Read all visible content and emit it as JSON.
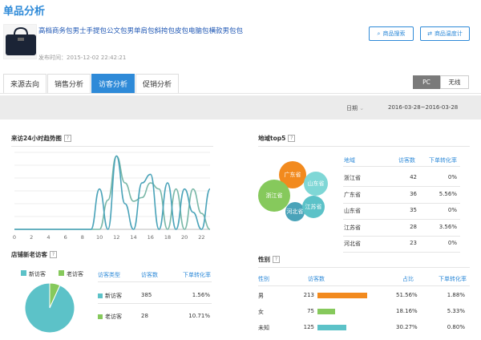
{
  "page_title": "单品分析",
  "product": {
    "name": "高档商务包男士手提包公文包男单肩包斜挎包皮包电脑包横款男包包",
    "publish_label": "发布时间：2015-12-02 22:42:21"
  },
  "buttons": {
    "search": "商品搜索",
    "temperature": "商品温度计"
  },
  "tabs": [
    "来源去向",
    "销售分析",
    "访客分析",
    "促销分析"
  ],
  "device": {
    "pc": "PC",
    "wireless": "无线"
  },
  "date": {
    "label": "日期",
    "range": "2016-03-28~2016-03-28"
  },
  "trend": {
    "title": "来访24小时趋势图",
    "x_ticks": [
      "0",
      "2",
      "4",
      "6",
      "8",
      "10",
      "12",
      "14",
      "16",
      "18",
      "20",
      "22"
    ]
  },
  "chart_data": {
    "type": "line",
    "x": [
      0,
      1,
      2,
      3,
      4,
      5,
      6,
      7,
      8,
      9,
      10,
      11,
      12,
      13,
      14,
      15,
      16,
      17,
      18,
      19,
      20,
      21,
      22,
      23
    ],
    "series": [
      {
        "color": "#7ab8a8",
        "values": [
          0,
          0,
          0,
          0,
          0,
          0,
          0,
          0,
          0,
          0,
          0,
          2.4,
          6,
          3.8,
          2.3,
          2.6,
          3.8,
          3.3,
          0,
          3.3,
          0,
          3.3,
          1.3,
          0
        ]
      },
      {
        "color": "#4aa3b9",
        "values": [
          0,
          0,
          0,
          0,
          0,
          0,
          0,
          0,
          0,
          0,
          3.3,
          0,
          6,
          2.1,
          0,
          3.8,
          4.5,
          0,
          3.8,
          0,
          3.3,
          1.4,
          0,
          3.3
        ]
      }
    ],
    "ylim": [
      0,
      6.3
    ]
  },
  "newold": {
    "title": "店铺新老访客",
    "legend": [
      "新访客",
      "老访客"
    ],
    "headers": [
      "访客类型",
      "访客数",
      "下单转化率"
    ],
    "rows": [
      {
        "type": "新访客",
        "count": "385",
        "rate": "1.56%",
        "color": "#5cc2c8"
      },
      {
        "type": "老访客",
        "count": "28",
        "rate": "10.71%",
        "color": "#86c95c"
      }
    ],
    "pie": {
      "new": 385,
      "old": 28
    }
  },
  "region": {
    "title": "地域top5",
    "headers": [
      "地域",
      "访客数",
      "下单转化率"
    ],
    "rows": [
      {
        "name": "浙江省",
        "count": "42",
        "rate": "0%"
      },
      {
        "name": "广东省",
        "count": "36",
        "rate": "5.56%"
      },
      {
        "name": "山东省",
        "count": "35",
        "rate": "0%"
      },
      {
        "name": "江苏省",
        "count": "28",
        "rate": "3.56%"
      },
      {
        "name": "河北省",
        "count": "23",
        "rate": "0%"
      }
    ],
    "bubbles": [
      "广东省",
      "浙江省",
      "山东省",
      "河北省",
      "江苏省"
    ]
  },
  "gender": {
    "title": "性别",
    "headers": [
      "性别",
      "访客数",
      "占比",
      "下单转化率"
    ],
    "rows": [
      {
        "name": "男",
        "count": "213",
        "share": "51.56%",
        "rate": "1.88%",
        "pct": 51.56,
        "color": "#f28a1e"
      },
      {
        "name": "女",
        "count": "75",
        "share": "18.16%",
        "rate": "5.33%",
        "pct": 18.16,
        "color": "#86c95c"
      },
      {
        "name": "未知",
        "count": "125",
        "share": "30.27%",
        "rate": "0.80%",
        "pct": 30.27,
        "color": "#5cc2c8"
      }
    ]
  }
}
